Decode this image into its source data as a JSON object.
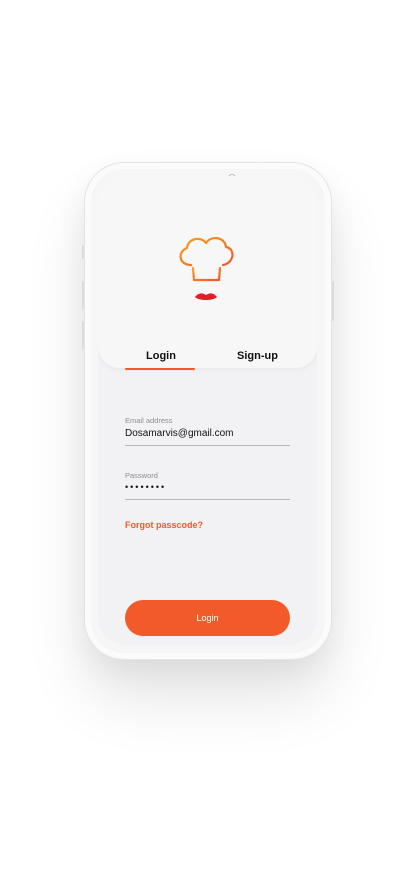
{
  "colors": {
    "accent": "#f35a29",
    "lips": "#e21d25",
    "logo_gradient_start": "#f6a21d",
    "logo_gradient_end": "#f0572a"
  },
  "tabs": [
    {
      "label": "Login",
      "active": true
    },
    {
      "label": "Sign-up",
      "active": false
    }
  ],
  "form": {
    "email_label": "Email address",
    "email_value": "Dosamarvis@gmail.com",
    "password_label": "Password",
    "password_value": "••••••••",
    "forgot_label": "Forgot passcode?",
    "submit_label": "Login"
  },
  "icons": {
    "logo": "chef-hat-icon",
    "lips": "lips-icon"
  }
}
